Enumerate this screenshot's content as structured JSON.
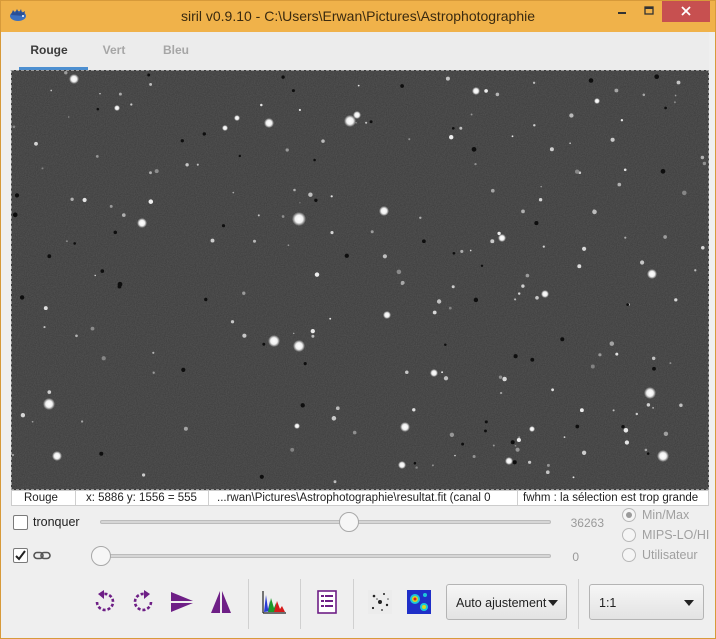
{
  "window": {
    "title": "siril v0.9.10 - C:\\Users\\Erwan\\Pictures\\Astrophotographie"
  },
  "tabs": [
    {
      "label": "Rouge",
      "active": true
    },
    {
      "label": "Vert",
      "active": false
    },
    {
      "label": "Bleu",
      "active": false
    }
  ],
  "statusbar": {
    "channel": "Rouge",
    "coords": "x: 5886 y: 1556 = 555",
    "file": "...rwan\\Pictures\\Astrophotographie\\resultat.fit (canal 0",
    "fwhm": "fwhm : la sélection est trop grande"
  },
  "sliders": {
    "high": {
      "checkbox_label": "tronquer",
      "checked": false,
      "value": "36263",
      "position_fraction": 0.55
    },
    "low": {
      "checked": true,
      "value": "0",
      "position_fraction": 0.0
    }
  },
  "scale_modes": [
    {
      "label": "Min/Max",
      "selected": true
    },
    {
      "label": "MIPS-LO/HI",
      "selected": false
    },
    {
      "label": "Utilisateur",
      "selected": false
    }
  ],
  "toolbar": {
    "auto_adjust_label": "Auto ajustement",
    "zoom_value": "1:1"
  },
  "colors": {
    "titlebar": "#f0b24a",
    "tab_accent": "#4d8fd0",
    "canvas_bg": "#3c3c3c",
    "rotate_icons": "#6e1f86",
    "close_button": "#c75050"
  },
  "icons": {
    "app": "hedgehog-icon",
    "minimize": "minimize-icon",
    "maximize": "maximize-icon",
    "close": "close-icon",
    "rotate_left": "rotate-left-icon",
    "rotate_right": "rotate-right-icon",
    "mirror_x": "mirror-horizontal-icon",
    "mirror_y": "mirror-vertical-icon",
    "histogram": "histogram-icon",
    "console": "console-log-icon",
    "negative": "negative-view-icon",
    "false_color": "false-color-icon",
    "link": "chain-link-icon"
  }
}
